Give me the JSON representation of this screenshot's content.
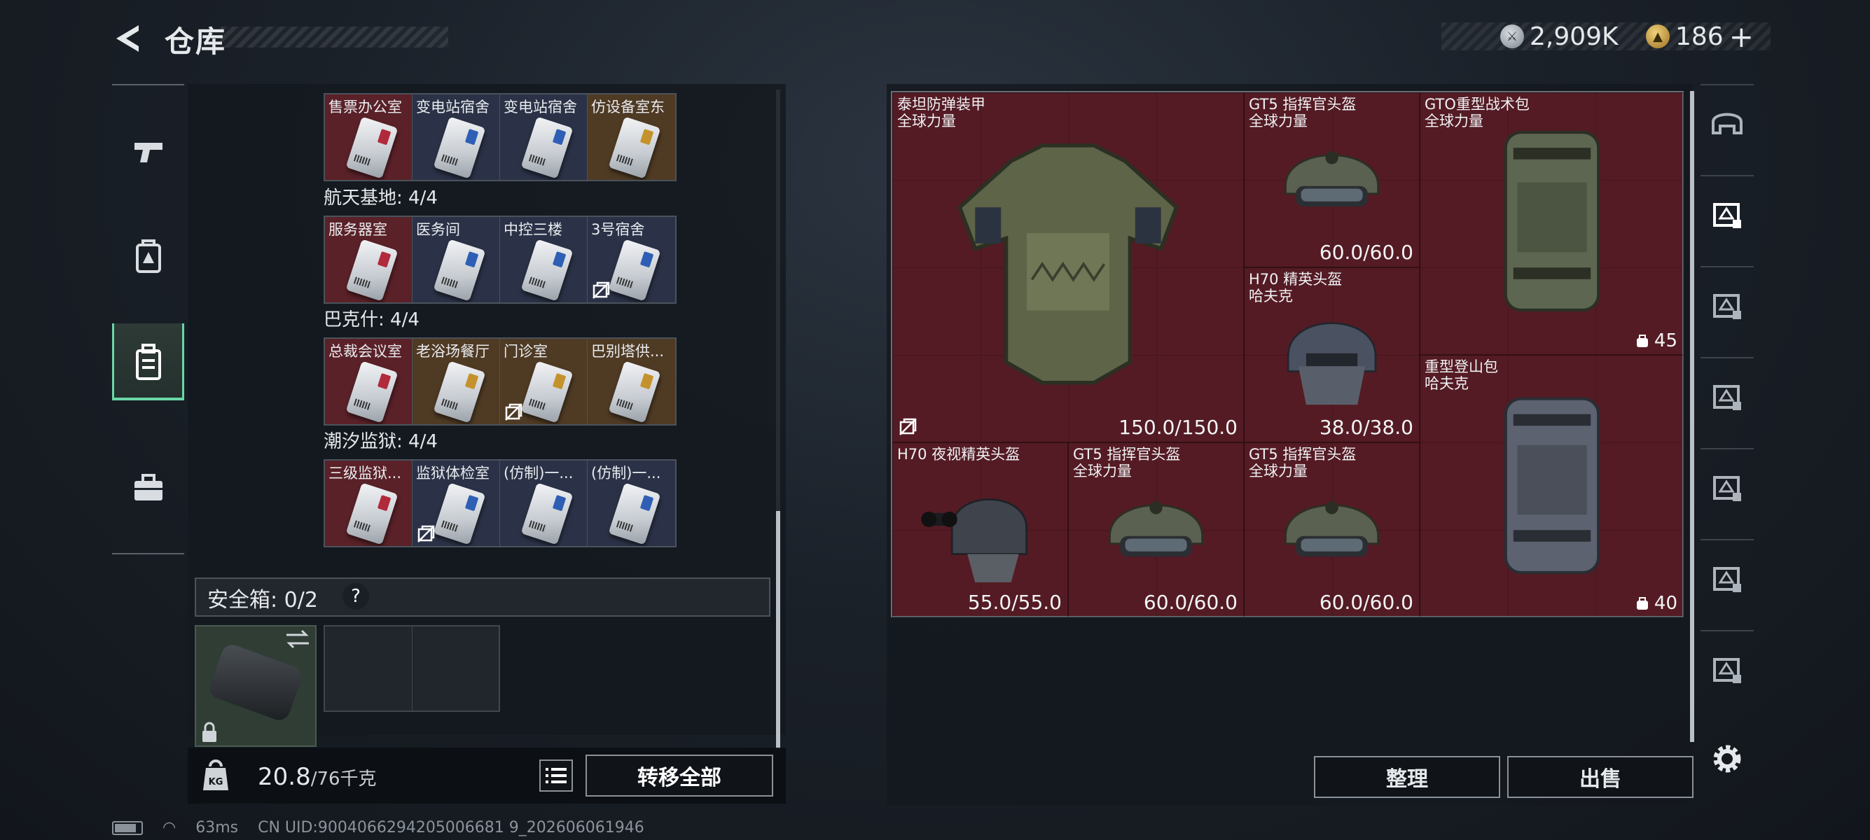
{
  "header": {
    "title": "仓库",
    "currency_silver": "2,909K",
    "currency_gold": "186",
    "plus_label": "+"
  },
  "left_nav": {
    "items": [
      {
        "icon": "pistol-icon"
      },
      {
        "icon": "backpack-rig-icon"
      },
      {
        "icon": "keycard-case-icon",
        "active": true
      },
      {
        "icon": "toolbox-icon"
      }
    ]
  },
  "keycards": {
    "top_row": [
      {
        "label": "售票办公室",
        "bg": "red"
      },
      {
        "label": "变电站宿舍",
        "bg": "blue"
      },
      {
        "label": "变电站宿舍",
        "bg": "blue"
      },
      {
        "label": "仿设备室东",
        "bg": "gold"
      }
    ],
    "groups": [
      {
        "title": "航天基地: 4/4",
        "cards": [
          {
            "label": "服务器室",
            "bg": "red"
          },
          {
            "label": "医务间",
            "bg": "blue"
          },
          {
            "label": "中控三楼",
            "bg": "blue"
          },
          {
            "label": "3号宿舍",
            "bg": "blue",
            "no_sell": true
          }
        ]
      },
      {
        "title": "巴克什: 4/4",
        "cards": [
          {
            "label": "总裁会议室",
            "bg": "red"
          },
          {
            "label": "老浴场餐厅",
            "bg": "gold"
          },
          {
            "label": "门诊室",
            "bg": "gold",
            "no_sell": true
          },
          {
            "label": "巴别塔供...",
            "bg": "gold"
          }
        ]
      },
      {
        "title": "潮汐监狱: 4/4",
        "cards": [
          {
            "label": "三级监狱...",
            "bg": "red"
          },
          {
            "label": "监狱体检室",
            "bg": "blue",
            "no_sell": true
          },
          {
            "label": "(仿制)一...",
            "bg": "blue"
          },
          {
            "label": "(仿制)一...",
            "bg": "blue"
          }
        ]
      }
    ]
  },
  "safebox": {
    "label": "安全箱: 0/2",
    "help": "?"
  },
  "footer_left": {
    "weight": "20.8",
    "weight_max": "/76千克",
    "transfer_all": "转移全部"
  },
  "inventory": [
    {
      "name": "泰坦防弹装甲",
      "sub": "全球力量",
      "durability": "150.0/150.0",
      "kind": "armor",
      "no_sell": true
    },
    {
      "name": "GT5 指挥官头盔",
      "sub": "全球力量",
      "durability": "60.0/60.0",
      "kind": "helmet"
    },
    {
      "name": "GTO重型战术包",
      "sub": "全球力量",
      "capacity": "45",
      "kind": "backpack-green"
    },
    {
      "name": "H70 精英头盔",
      "sub": "哈夫克",
      "durability": "38.0/38.0",
      "kind": "helmet-dark"
    },
    {
      "name": "重型登山包",
      "sub": "哈夫克",
      "capacity": "40",
      "kind": "backpack-grey"
    },
    {
      "name": "H70 夜视精英头盔",
      "sub": "",
      "durability": "55.0/55.0",
      "kind": "helmet-nv"
    },
    {
      "name": "GT5 指挥官头盔",
      "sub": "全球力量",
      "durability": "60.0/60.0",
      "kind": "helmet"
    },
    {
      "name": "GT5 指挥官头盔",
      "sub": "全球力量",
      "durability": "60.0/60.0",
      "kind": "helmet"
    }
  ],
  "footer_right": {
    "sort": "整理",
    "sell": "出售"
  },
  "right_nav": {
    "items": [
      "helmet-slot-icon",
      "armor-slot-icon-1",
      "armor-slot-icon-2",
      "armor-slot-icon-3",
      "vest-slot-icon",
      "chest-rig-slot-icon",
      "backpack-slot-icon"
    ]
  },
  "status": {
    "ping": "63ms",
    "uid": "CN UID:9004066294205006681 9_202606061946"
  },
  "colors": {
    "accent": "#6ad7a6",
    "inventory_bg": "#541b24"
  }
}
